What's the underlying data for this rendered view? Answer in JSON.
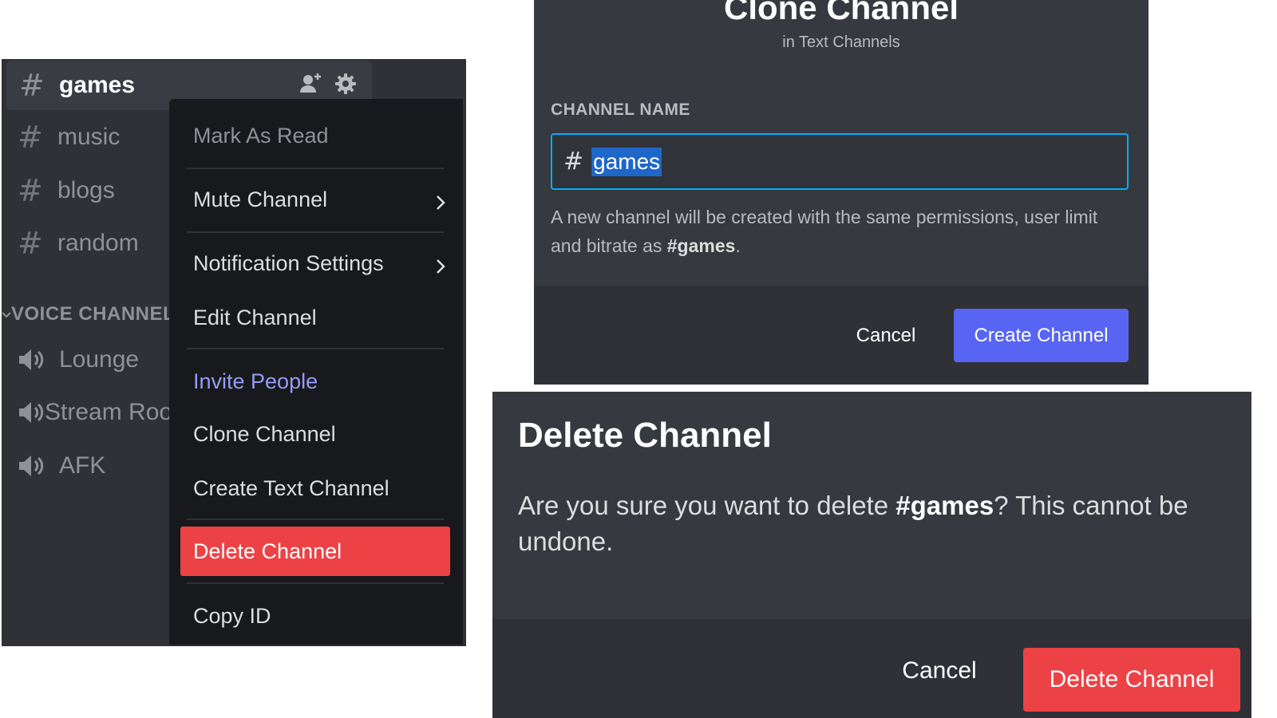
{
  "sidebar": {
    "text_channels": [
      {
        "name": "games",
        "selected": true
      },
      {
        "name": "music"
      },
      {
        "name": "blogs"
      },
      {
        "name": "random"
      }
    ],
    "hash_symbol": "#",
    "channel_action_icons": [
      "add-member-icon",
      "gear-icon"
    ],
    "voice_category": "VOICE CHANNELS",
    "voice_channels": [
      {
        "name": "Lounge"
      },
      {
        "name": "Stream Room"
      },
      {
        "name": "AFK"
      }
    ]
  },
  "context_menu": {
    "items": [
      {
        "label": "Mark As Read",
        "style": "muted"
      },
      {
        "label": "Mute Channel",
        "submenu": true
      },
      {
        "label": "Notification Settings",
        "submenu": true
      },
      {
        "label": "Edit Channel"
      },
      {
        "label": "Invite People",
        "style": "accent"
      },
      {
        "label": "Clone Channel"
      },
      {
        "label": "Create Text Channel"
      },
      {
        "label": "Delete Channel",
        "style": "danger-highlighted"
      },
      {
        "label": "Copy ID"
      }
    ]
  },
  "clone_modal": {
    "title": "Clone Channel",
    "subtitle": "in Text Channels",
    "field_label": "CHANNEL NAME",
    "hash_symbol": "#",
    "input_value": "games",
    "description_pre": "A new channel will be created with the same permissions, user limit and bitrate as ",
    "description_channel": "#games",
    "description_post": ".",
    "cancel_label": "Cancel",
    "create_label": "Create Channel"
  },
  "delete_modal": {
    "title": "Delete Channel",
    "body_pre": "Are you sure you want to delete ",
    "body_channel": "#games",
    "body_post": "? This cannot be undone.",
    "cancel_label": "Cancel",
    "confirm_label": "Delete Channel"
  },
  "colors": {
    "blurple": "#5865f2",
    "danger": "#ed4245",
    "input_focus": "#00b0f4",
    "accent_text": "#949cf7"
  }
}
